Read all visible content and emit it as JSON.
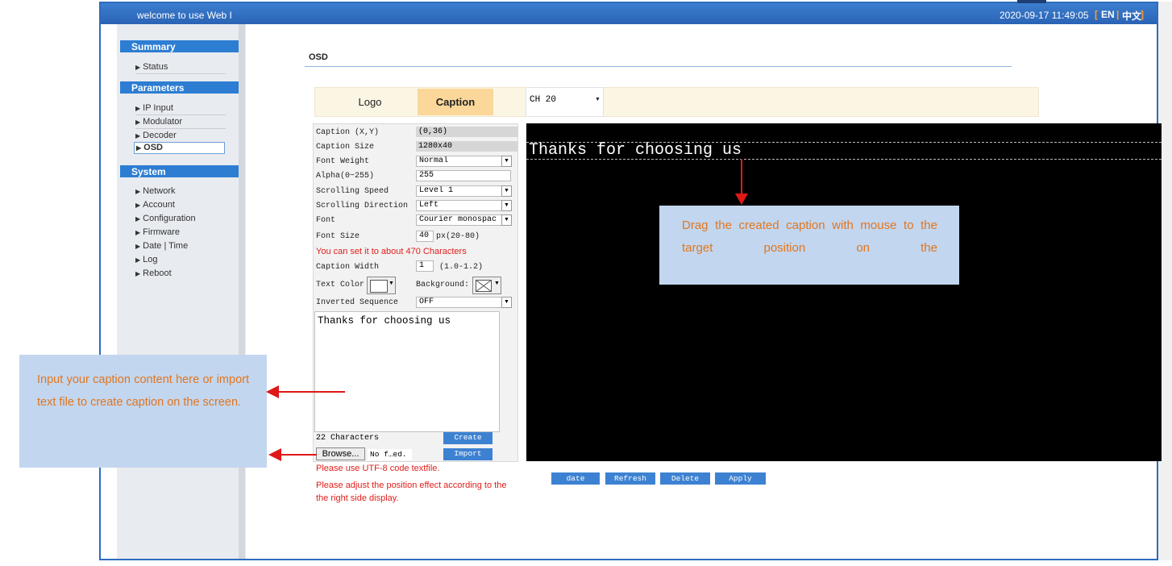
{
  "header": {
    "welcome": "welcome to use Web I",
    "datetime": "2020-09-17 11:49:05",
    "lang_open": "[",
    "lang_en": "EN",
    "lang_sep": "|",
    "lang_cn": "中文",
    "lang_close": "]"
  },
  "sidebar": {
    "summary": {
      "title": "Summary",
      "items": [
        "Status"
      ]
    },
    "parameters": {
      "title": "Parameters",
      "items": [
        "IP Input",
        "Modulator",
        "Decoder",
        "OSD"
      ]
    },
    "system": {
      "title": "System",
      "items": [
        "Network",
        "Account",
        "Configuration",
        "Firmware",
        "Date | Time",
        "Log",
        "Reboot"
      ]
    }
  },
  "content": {
    "title": "OSD",
    "tabs": {
      "logo": "Logo",
      "caption": "Caption"
    },
    "channel": "CH 20"
  },
  "settings": {
    "caption_xy": {
      "label": "Caption (X,Y)",
      "value": "(0,36)"
    },
    "caption_size": {
      "label": "Caption Size",
      "value": "1280x40"
    },
    "font_weight": {
      "label": "Font Weight",
      "value": "Normal"
    },
    "alpha": {
      "label": "Alpha(0~255)",
      "value": "255"
    },
    "scroll_speed": {
      "label": "Scrolling Speed",
      "value": "Level 1"
    },
    "scroll_dir": {
      "label": "Scrolling Direction",
      "value": "Left"
    },
    "font": {
      "label": "Font",
      "value": "Courier monospac"
    },
    "font_size": {
      "label": "Font Size",
      "value": "40",
      "unit": "px(20-80)"
    },
    "tip": "You can set it to about 470 Characters",
    "caption_width": {
      "label": "Caption Width",
      "value": "1",
      "range": "(1.0-1.2)"
    },
    "text_color": {
      "label": "Text Color"
    },
    "background": {
      "label": "Background:"
    },
    "inverted": {
      "label": "Inverted Sequence",
      "value": "OFF"
    },
    "caption_text": "Thanks for choosing us",
    "char_count": "22 Characters",
    "create_label": "Create",
    "import_label": "Import",
    "browse_label": "Browse...",
    "file_name": "No f…ed.",
    "note_utf8": "Please use UTF-8 code textfile.",
    "note_position": "Please adjust the position effect according to the the right side display."
  },
  "preview": {
    "caption_text": "Thanks for choosing us"
  },
  "actions": {
    "date": "date",
    "refresh": "Refresh",
    "delete": "Delete",
    "apply": "Apply"
  },
  "callouts": {
    "right": "Drag the created caption with mouse to the target position on the",
    "left": "Input your caption content here or import text file to create caption on the screen."
  },
  "colors": {
    "accent_blue": "#2d7dd2",
    "tab_active": "#fbd79a",
    "warning_red": "#e0201c",
    "callout_bg": "#c3d6ef",
    "callout_text": "#e0761e"
  }
}
